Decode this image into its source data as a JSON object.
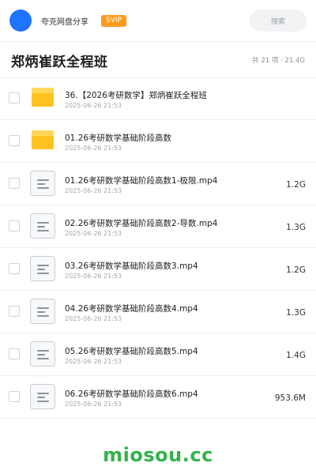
{
  "header": {
    "share_name": "夸克网盘分享",
    "badge": "SVIP",
    "search_label": "搜索"
  },
  "title_bar": {
    "title": "郑炳崔跃全程班",
    "meta": "共 21 项 · 21.4G"
  },
  "items": [
    {
      "type": "folder",
      "icon": "folder-icon",
      "name": "36.【2026考研数学】郑炳崔跃全程班",
      "date": "2025-06-26 21:53",
      "size": ""
    },
    {
      "type": "folder",
      "icon": "folder-icon",
      "name": "01.26考研数学基础阶段高数",
      "date": "2025-06-26 21:53",
      "size": ""
    },
    {
      "type": "file",
      "icon": "file-icon",
      "name": "01.26考研数学基础阶段高数1-极限.mp4",
      "date": "2025-06-26 21:53",
      "size": "1.2G"
    },
    {
      "type": "file",
      "icon": "file-icon",
      "name": "02.26考研数学基础阶段高数2-导数.mp4",
      "date": "2025-06-26 21:53",
      "size": "1.3G"
    },
    {
      "type": "file",
      "icon": "file-icon",
      "name": "03.26考研数学基础阶段高数3.mp4",
      "date": "2025-06-26 21:53",
      "size": "1.2G"
    },
    {
      "type": "file",
      "icon": "file-icon",
      "name": "04.26考研数学基础阶段高数4.mp4",
      "date": "2025-06-26 21:53",
      "size": "1.3G"
    },
    {
      "type": "file",
      "icon": "file-icon",
      "name": "05.26考研数学基础阶段高数5.mp4",
      "date": "2025-06-26 21:53",
      "size": "1.4G"
    },
    {
      "type": "file",
      "icon": "file-icon",
      "name": "06.26考研数学基础阶段高数6.mp4",
      "date": "2025-06-26 21:53",
      "size": "953.6M"
    }
  ],
  "watermark": "miosou.cc",
  "colors": {
    "avatar": "#1f73ff",
    "badge": "#ff9a1f",
    "folder": "#ffc21f",
    "watermark": "#33b24a"
  }
}
